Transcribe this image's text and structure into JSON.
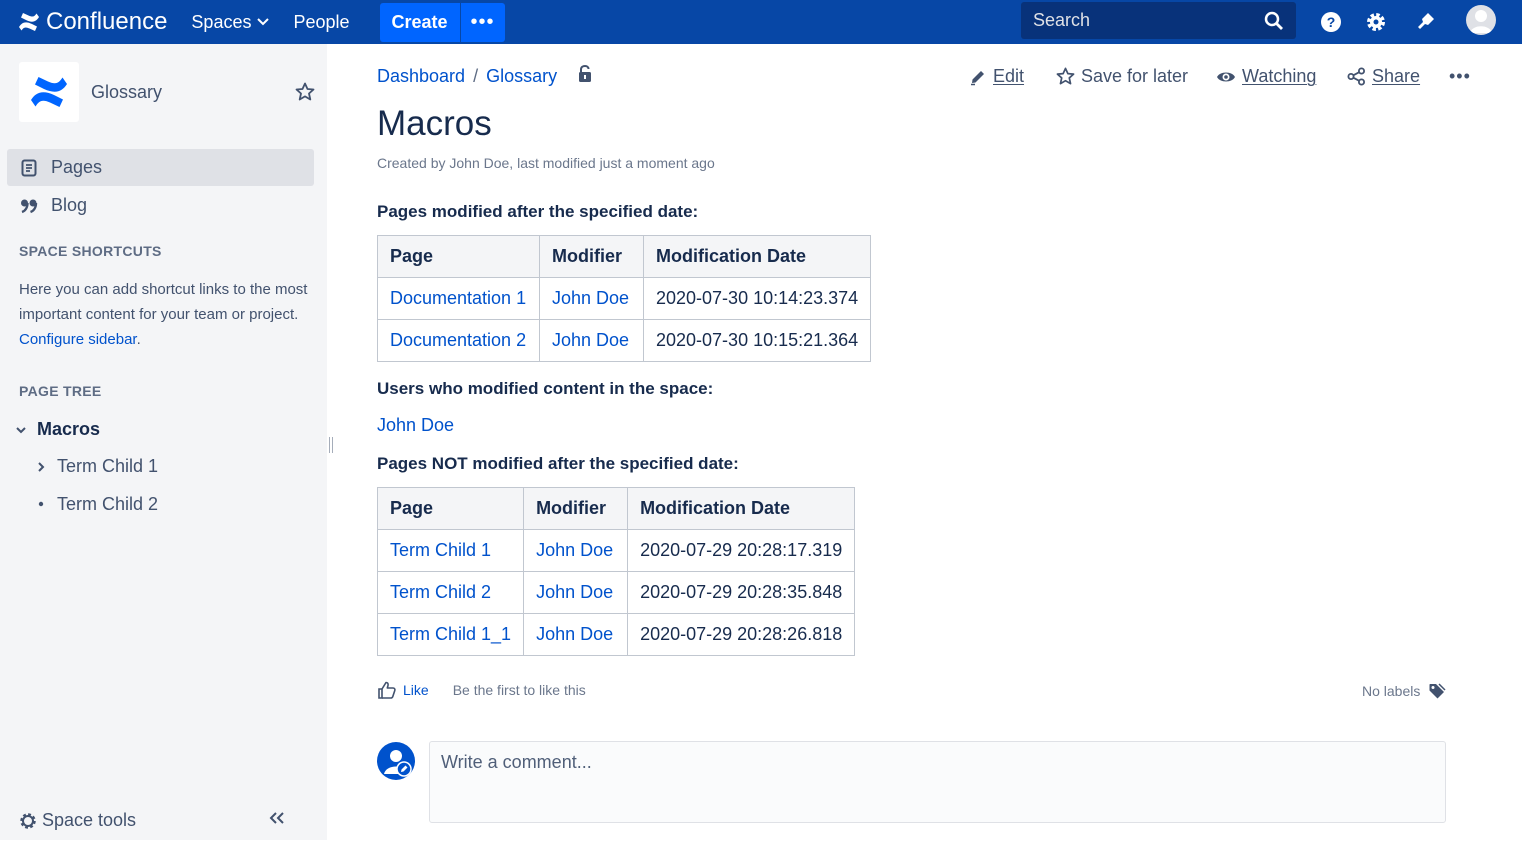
{
  "topnav": {
    "brand": "Confluence",
    "spaces_label": "Spaces",
    "people_label": "People",
    "create_label": "Create",
    "more_label": "•••",
    "search_placeholder": "Search",
    "colors": {
      "bar": "#0747a6",
      "create": "#0065ff"
    },
    "icons": [
      "help-icon",
      "settings-icon",
      "notifications-icon",
      "user-avatar-icon"
    ]
  },
  "sidebar": {
    "space_name": "Glossary",
    "nav": [
      {
        "label": "Pages",
        "icon": "pages-icon",
        "active": true
      },
      {
        "label": "Blog",
        "icon": "blog-quote-icon",
        "active": false
      }
    ],
    "shortcuts_heading": "SPACE SHORTCUTS",
    "shortcuts_text": "Here you can add shortcut links to the most important content for your team or project.",
    "configure_link": "Configure sidebar",
    "configure_suffix": ".",
    "page_tree_heading": "PAGE TREE",
    "tree": {
      "root": "Macros",
      "children": [
        {
          "label": "Term Child 1",
          "marker": "chevron-right"
        },
        {
          "label": "Term Child 2",
          "marker": "bullet"
        }
      ]
    },
    "space_tools": "Space tools"
  },
  "breadcrumb": {
    "items": [
      "Dashboard",
      "Glossary"
    ],
    "separator": "/"
  },
  "actions": {
    "edit": "Edit",
    "save_for_later": "Save for later",
    "watching": "Watching",
    "share": "Share",
    "more": "•••"
  },
  "page": {
    "title": "Macros",
    "byline": "Created by John Doe, last modified just a moment ago"
  },
  "section1": {
    "heading": "Pages modified after the specified date:",
    "columns": [
      "Page",
      "Modifier",
      "Modification Date"
    ],
    "rows": [
      [
        "Documentation 1",
        "John Doe",
        "2020-07-30 10:14:23.374"
      ],
      [
        "Documentation 2",
        "John Doe",
        "2020-07-30 10:15:21.364"
      ]
    ]
  },
  "section2": {
    "heading": "Users who modified content in the space:",
    "user": "John Doe"
  },
  "section3": {
    "heading": "Pages NOT modified after the specified date:",
    "columns": [
      "Page",
      "Modifier",
      "Modification Date"
    ],
    "rows": [
      [
        "Term Child 1",
        "John Doe",
        "2020-07-29 20:28:17.319"
      ],
      [
        "Term Child 2",
        "John Doe",
        "2020-07-29 20:28:35.848"
      ],
      [
        "Term Child 1_1",
        "John Doe",
        "2020-07-29 20:28:26.818"
      ]
    ]
  },
  "footer": {
    "like": "Like",
    "like_hint": "Be the first to like this",
    "labels": "No labels",
    "comment_placeholder": "Write a comment..."
  }
}
